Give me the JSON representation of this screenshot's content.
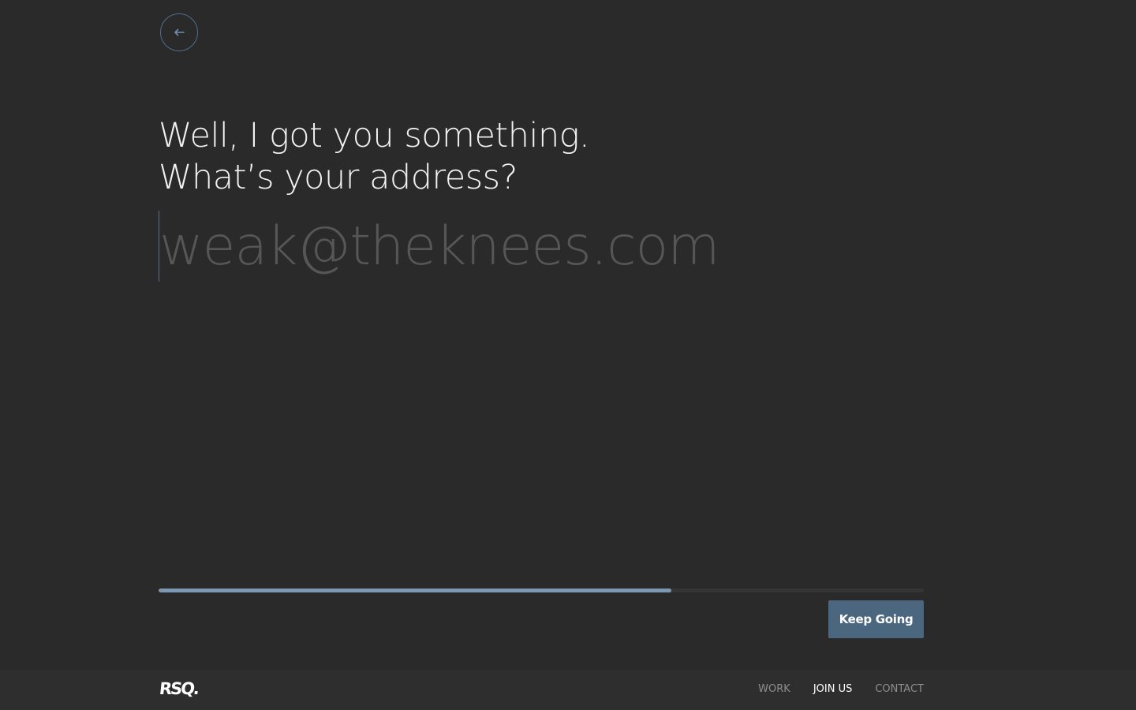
{
  "back": {
    "icon": "arrow-left-icon"
  },
  "question": {
    "line1": "Well, I got you something.",
    "line2": "What’s your address?"
  },
  "email": {
    "value": "",
    "placeholder": "weak@theknees.com"
  },
  "progress": {
    "fraction": 0.67
  },
  "actions": {
    "keep_going_label": "Keep Going"
  },
  "footer": {
    "logo": "RSQ.",
    "nav": [
      {
        "label": "WORK",
        "active": false
      },
      {
        "label": "JOIN US",
        "active": true
      },
      {
        "label": "CONTACT",
        "active": false
      }
    ]
  },
  "colors": {
    "background": "#2a2a2a",
    "accent": "#4b6780",
    "progress": "#7d98b1"
  }
}
